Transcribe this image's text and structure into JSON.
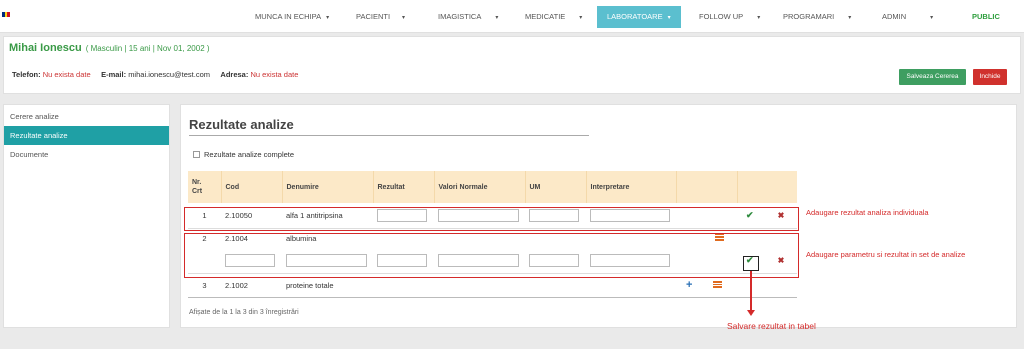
{
  "nav": {
    "items": [
      {
        "label": "MUNCA IN ECHIPA",
        "caret": "▾"
      },
      {
        "label": "PACIENTI",
        "caret": "▾"
      },
      {
        "label": "IMAGISTICA",
        "caret": "▾"
      },
      {
        "label": "MEDICATIE",
        "caret": "▾"
      },
      {
        "label": "LABORATOARE",
        "caret": "▾"
      },
      {
        "label": "FOLLOW UP",
        "caret": "▾"
      },
      {
        "label": "PROGRAMARI",
        "caret": "▾"
      },
      {
        "label": "ADMIN",
        "caret": "▾"
      },
      {
        "label": "PUBLIC"
      }
    ],
    "active": "LABORATOARE",
    "flag_colors": [
      "#002b7f",
      "#fcd116",
      "#ce1126"
    ]
  },
  "patient": {
    "name": "Mihai Ionescu",
    "info": "( Masculin | 15 ani | Nov 01, 2002 )",
    "phone_label": "Telefon:",
    "phone_value": "Nu exista date",
    "email_label": "E-mail:",
    "email_value": "mihai.ionescu@test.com",
    "address_label": "Adresa:",
    "address_value": "Nu exista date"
  },
  "buttons": {
    "save": "Salveaza Cererea",
    "close": "Inchide"
  },
  "sidebar": {
    "items": [
      {
        "label": "Cerere analize"
      },
      {
        "label": "Rezultate analize"
      },
      {
        "label": "Documente"
      }
    ],
    "active": "Rezultate analize"
  },
  "main": {
    "title": "Rezultate analize",
    "checkbox_label": "Rezultate analize complete",
    "footer": "Afișate de la 1 la 3 din 3 înregistrări"
  },
  "table": {
    "headers": {
      "nr": "Nr.\nCrt",
      "cod": "Cod",
      "denumire": "Denumire",
      "rezultat": "Rezultat",
      "valori": "Valori Normale",
      "um": "UM",
      "interpretare": "Interpretare"
    },
    "rows": [
      {
        "nr": "1",
        "cod": "2.10050",
        "denumire": "alfa 1 antitripsina"
      },
      {
        "nr": "2",
        "cod": "2.1004",
        "denumire": "albumina"
      },
      {
        "nr": "3",
        "cod": "2.1002",
        "denumire": "proteine totale"
      }
    ],
    "icons": {
      "confirm": "check-icon",
      "delete": "close-icon",
      "add": "plus-icon",
      "list": "list-icon"
    }
  },
  "annotations": {
    "individual": "Adaugare rezultat analiza individuala",
    "set": "Adaugare parametru si rezultat in set de analize",
    "save": "Salvare rezultat in tabel",
    "color": "#d42a2a"
  }
}
